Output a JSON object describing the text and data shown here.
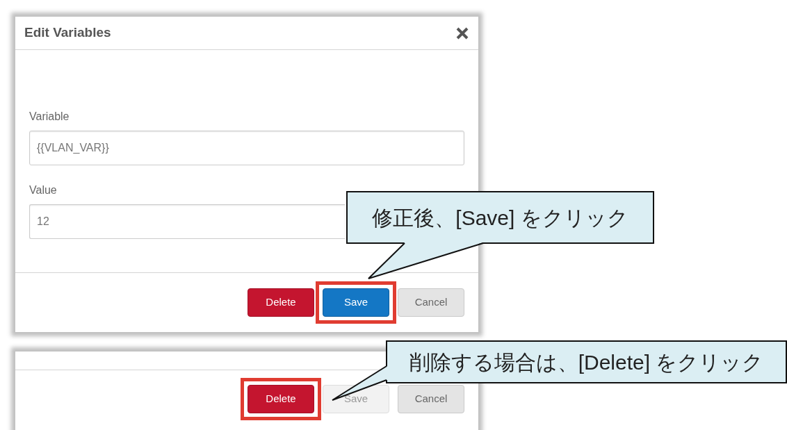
{
  "dialog": {
    "title": "Edit Variables",
    "fields": [
      {
        "label": "Variable",
        "value": "{{VLAN_VAR}}"
      },
      {
        "label": "Value",
        "value": "12"
      }
    ],
    "buttons": [
      {
        "label": "Delete",
        "kind": "delete",
        "disabled": false,
        "highlighted": false
      },
      {
        "label": "Save",
        "kind": "save",
        "disabled": false,
        "highlighted": true
      },
      {
        "label": "Cancel",
        "kind": "cancel",
        "disabled": false,
        "highlighted": false
      }
    ]
  },
  "dialog_footer": {
    "buttons": [
      {
        "label": "Delete",
        "kind": "delete",
        "disabled": false,
        "highlighted": true
      },
      {
        "label": "Save",
        "kind": "save",
        "disabled": true,
        "highlighted": false
      },
      {
        "label": "Cancel",
        "kind": "cancel",
        "disabled": false,
        "highlighted": false
      }
    ]
  },
  "callouts": [
    {
      "text": "修正後、[Save] をクリック"
    },
    {
      "text": "削除する場合は、[Delete] をクリック"
    }
  ]
}
